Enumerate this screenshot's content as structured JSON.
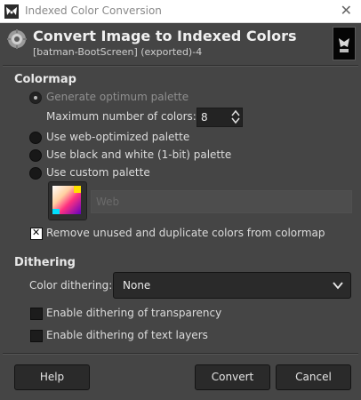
{
  "window": {
    "title": "Indexed Color Conversion",
    "close_glyph": "✕"
  },
  "header": {
    "title": "Convert Image to Indexed Colors",
    "subtitle": "[batman-BootScreen] (exported)-4",
    "icon": "convert-gear-icon",
    "thumbnail": "image-thumbnail"
  },
  "colormap": {
    "heading": "Colormap",
    "options": [
      {
        "label": "Generate optimum palette",
        "checked": true
      },
      {
        "label": "Use web-optimized palette",
        "checked": false
      },
      {
        "label": "Use black and white (1-bit) palette",
        "checked": false
      },
      {
        "label": "Use custom palette",
        "checked": false
      }
    ],
    "max_colors_label": "Maximum number of colors:",
    "max_colors_value": "8",
    "palette_name": "Web",
    "remove_unused_label": "Remove unused and duplicate colors from colormap",
    "remove_unused_checked": true
  },
  "dithering": {
    "heading": "Dithering",
    "color_dithering_label": "Color dithering:",
    "color_dithering_value": "None",
    "transparency_label": "Enable dithering of transparency",
    "transparency_checked": false,
    "text_layers_label": "Enable dithering of text layers",
    "text_layers_checked": false
  },
  "buttons": {
    "help": "Help",
    "convert": "Convert",
    "cancel": "Cancel"
  }
}
